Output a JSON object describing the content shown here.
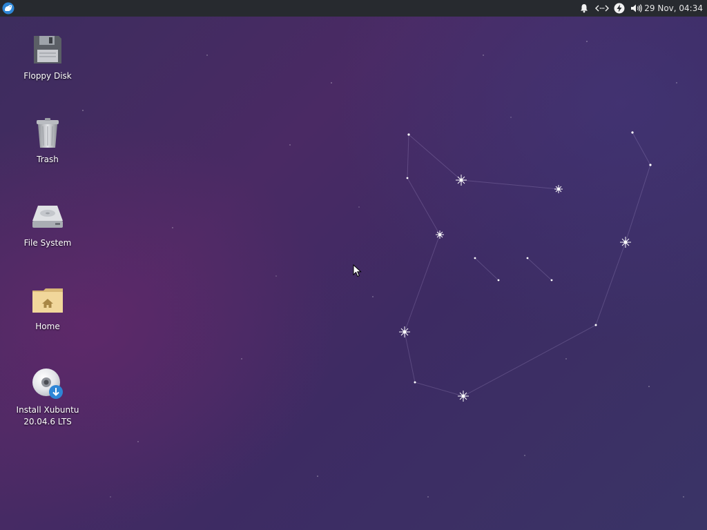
{
  "panel": {
    "menu_icon": "xfce-mouse-logo-icon",
    "tray_icons": [
      "notification-bell-icon",
      "network-wired-icon",
      "power-manager-icon",
      "volume-icon"
    ],
    "clock": "29 Nov, 04:34"
  },
  "desktop": {
    "icons": [
      {
        "label": "Floppy Disk",
        "icon": "floppy-disk-icon"
      },
      {
        "label": "Trash",
        "icon": "trash-icon"
      },
      {
        "label": "File System",
        "icon": "hard-drive-icon"
      },
      {
        "label": "Home",
        "icon": "home-folder-icon"
      },
      {
        "label": "Install Xubuntu\n20.04.6 LTS",
        "label_line1": "Install Xubuntu",
        "label_line2": "20.04.6 LTS",
        "icon": "install-disc-icon"
      }
    ]
  },
  "colors": {
    "panel_bg": "#272a2f",
    "wallpaper_base": "#3d2b63",
    "xfce_blue": "#2e86d6"
  }
}
